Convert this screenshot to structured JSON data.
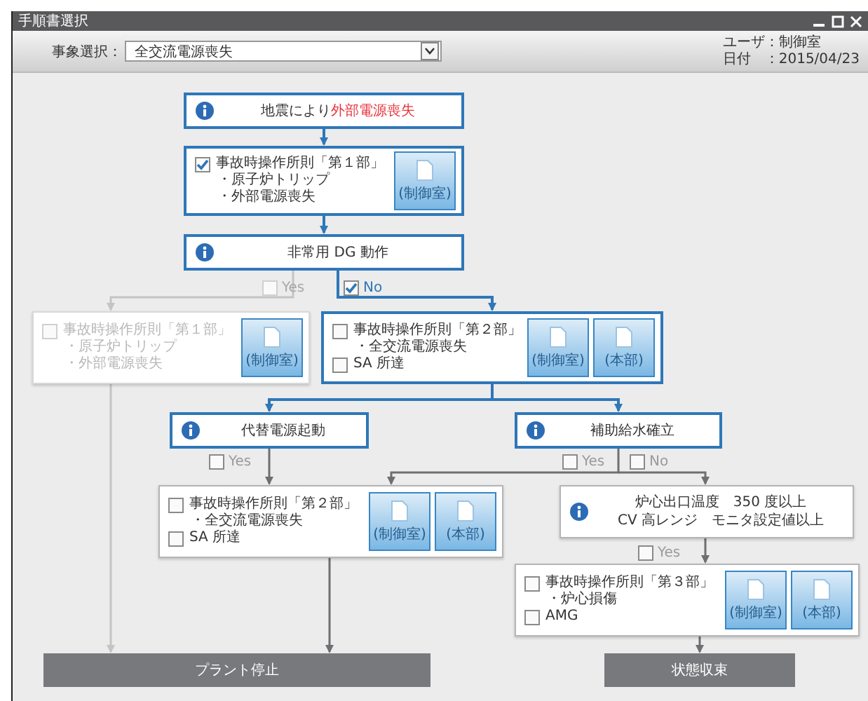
{
  "window": {
    "title": "手順書選択"
  },
  "toolbar": {
    "event_label": "事象選択：",
    "event_value": "全交流電源喪失",
    "user_label": "ユーザ：制御室",
    "date_label": "日付　：2015/04/23"
  },
  "nodes": [
    {
      "kind": "info",
      "active": true,
      "disabled": false,
      "lines": [
        "地震により"
      ],
      "alert_text": "外部電源喪失"
    },
    {
      "kind": "procedure",
      "active": true,
      "disabled": false,
      "checked": true,
      "title": "事故時操作所則「第１部」",
      "bullets": [
        "・原子炉トリップ",
        "・外部電源喪失"
      ],
      "buttons": [
        "(制御室)"
      ]
    },
    {
      "kind": "info",
      "active": true,
      "disabled": false,
      "lines": [
        "非常用 DG 動作"
      ],
      "options": [
        {
          "label": "Yes",
          "checked": false,
          "disabled": true
        },
        {
          "label": "No",
          "checked": true,
          "disabled": false
        }
      ]
    },
    {
      "kind": "procedure",
      "active": false,
      "disabled": true,
      "checked": false,
      "title": "事故時操作所則「第１部」",
      "bullets": [
        "・原子炉トリップ",
        "・外部電源喪失"
      ],
      "buttons": [
        "(制御室)"
      ]
    },
    {
      "kind": "procedure",
      "active": true,
      "disabled": false,
      "checked": false,
      "title": "事故時操作所則「第２部」",
      "bullets": [
        "・全交流電源喪失"
      ],
      "extras": [
        {
          "label": "SA 所達",
          "checked": false
        }
      ],
      "buttons": [
        "(制御室)",
        "(本部)"
      ]
    },
    {
      "kind": "info",
      "active": true,
      "disabled": false,
      "lines": [
        "代替電源起動"
      ],
      "options": [
        {
          "label": "Yes",
          "checked": false,
          "disabled": false
        }
      ]
    },
    {
      "kind": "info",
      "active": true,
      "disabled": false,
      "lines": [
        "補助給水確立"
      ],
      "options": [
        {
          "label": "Yes",
          "checked": false,
          "disabled": false
        },
        {
          "label": "No",
          "checked": false,
          "disabled": false
        }
      ]
    },
    {
      "kind": "procedure",
      "active": false,
      "disabled": false,
      "checked": false,
      "title": "事故時操作所則「第２部」",
      "bullets": [
        "・全交流電源喪失"
      ],
      "extras": [
        {
          "label": "SA 所達",
          "checked": false
        }
      ],
      "buttons": [
        "(制御室)",
        "(本部)"
      ]
    },
    {
      "kind": "info",
      "active": false,
      "disabled": false,
      "lines": [
        "炉心出口温度　350 度以上",
        "CV 高レンジ　モニタ設定値以上"
      ],
      "options": [
        {
          "label": "Yes",
          "checked": false,
          "disabled": false
        }
      ]
    },
    {
      "kind": "procedure",
      "active": false,
      "disabled": false,
      "checked": false,
      "title": "事故時操作所則「第３部」",
      "bullets": [
        "・炉心損傷"
      ],
      "extras": [
        {
          "label": "AMG",
          "checked": false
        }
      ],
      "buttons": [
        "(制御室)",
        "(本部)"
      ]
    },
    {
      "kind": "terminal",
      "label": "プラント停止"
    },
    {
      "kind": "terminal",
      "label": "状態収束"
    }
  ]
}
